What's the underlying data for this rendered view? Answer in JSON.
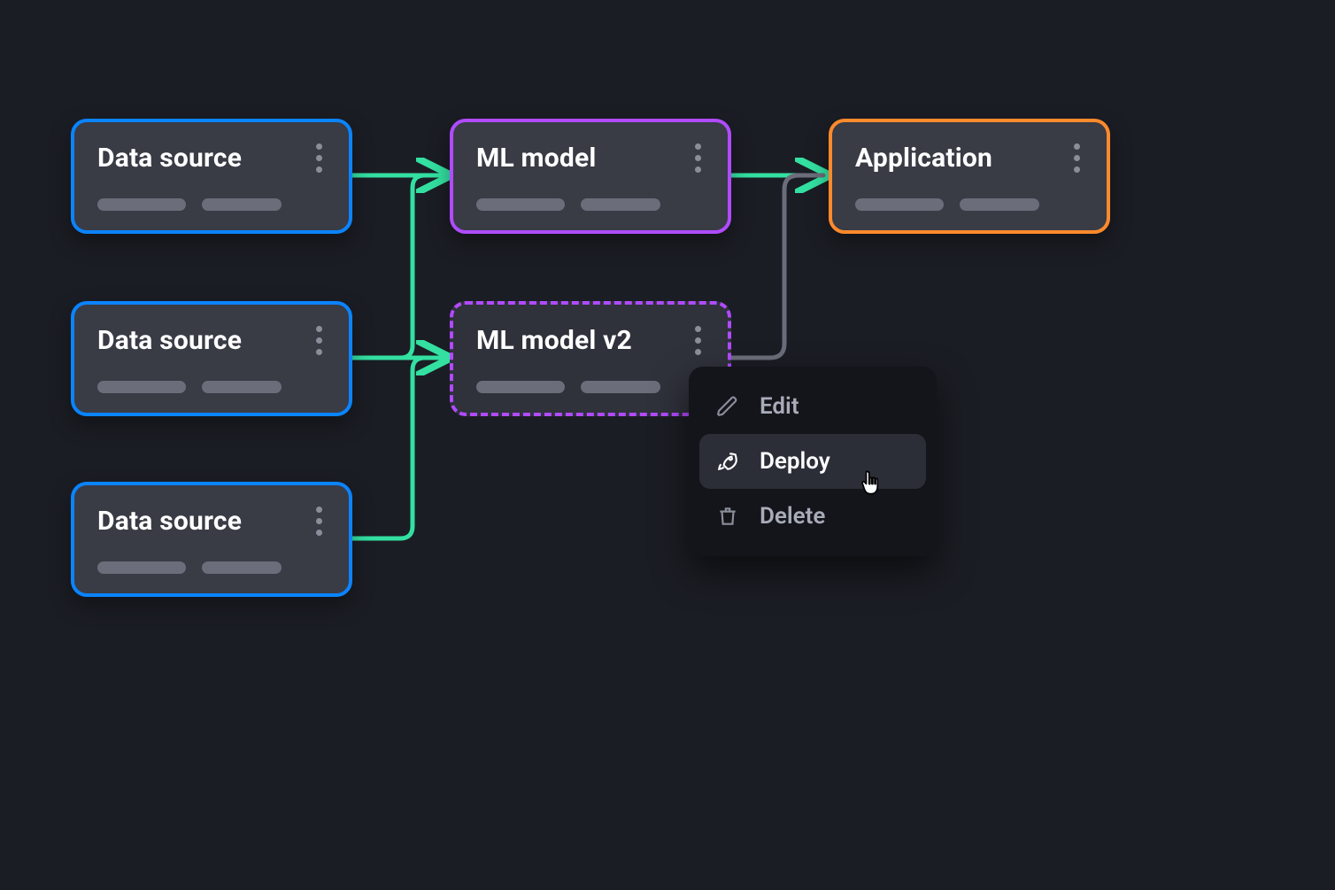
{
  "nodes": {
    "ds1": {
      "title": "Data source"
    },
    "ds2": {
      "title": "Data source"
    },
    "ds3": {
      "title": "Data source"
    },
    "ml": {
      "title": "ML model"
    },
    "mlv2": {
      "title": "ML model v2"
    },
    "app": {
      "title": "Application"
    }
  },
  "menu": {
    "edit": {
      "label": "Edit"
    },
    "deploy": {
      "label": "Deploy"
    },
    "delete": {
      "label": "Delete"
    }
  },
  "colors": {
    "blue": "#0a84ff",
    "purple": "#b04bff",
    "orange": "#ff8a2c",
    "arrow": "#33e0a1",
    "greyArrow": "#6b6e7a"
  }
}
